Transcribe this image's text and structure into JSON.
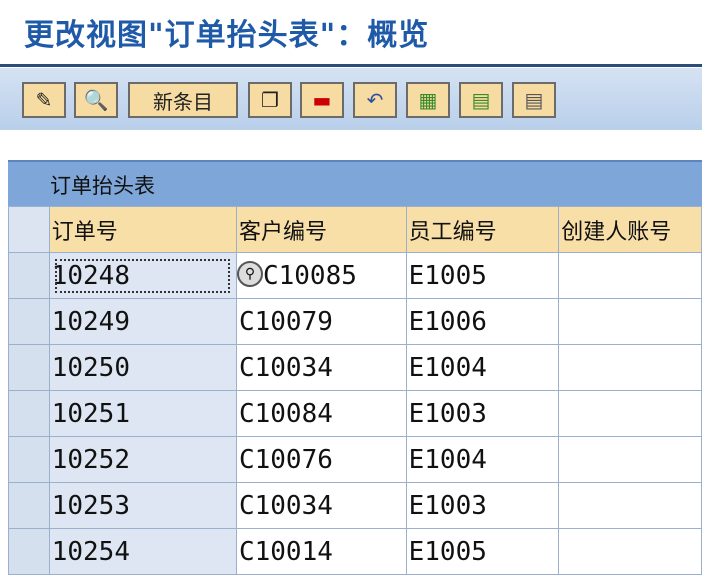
{
  "window_title": "更改视图\"订单抬头表\"：概览",
  "toolbar": {
    "new_entries_label": "新条目"
  },
  "table": {
    "title": "订单抬头表",
    "columns": [
      "订单号",
      "客户编号",
      "员工编号",
      "创建人账号"
    ],
    "rows": [
      [
        "10248",
        "C10085",
        "E1005",
        ""
      ],
      [
        "10249",
        "C10079",
        "E1006",
        ""
      ],
      [
        "10250",
        "C10034",
        "E1004",
        ""
      ],
      [
        "10251",
        "C10084",
        "E1003",
        ""
      ],
      [
        "10252",
        "C10076",
        "E1004",
        ""
      ],
      [
        "10253",
        "C10034",
        "E1003",
        ""
      ],
      [
        "10254",
        "C10014",
        "E1005",
        ""
      ]
    ],
    "first_row_customer_visible": "0085"
  }
}
